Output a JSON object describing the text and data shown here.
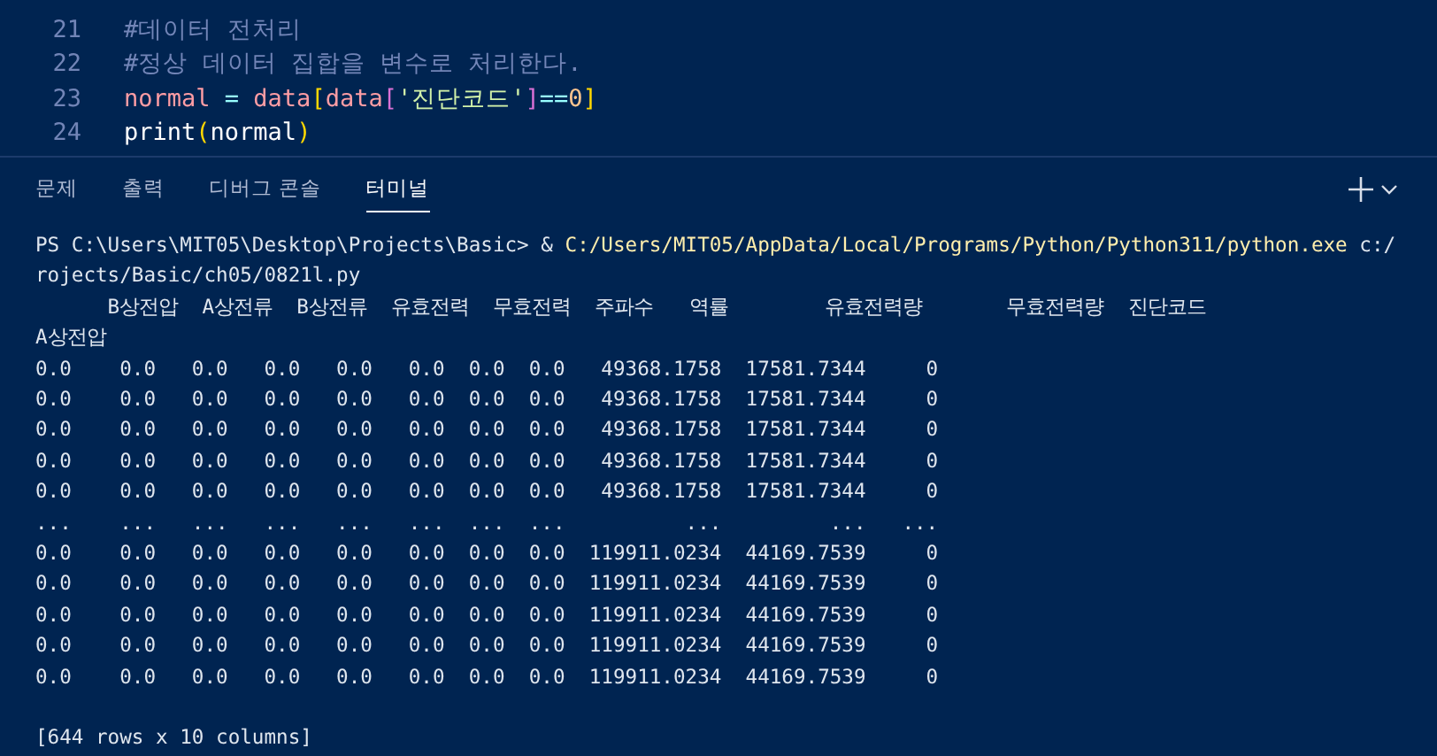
{
  "editor": {
    "lines": [
      {
        "number": "21",
        "tokens": [
          {
            "kind": "comment",
            "text": "#데이터 전처리"
          }
        ]
      },
      {
        "number": "22",
        "tokens": [
          {
            "kind": "comment",
            "text": "#정상 데이터 집합을 변수로 처리한다."
          }
        ]
      },
      {
        "number": "23",
        "tokens": [
          {
            "kind": "variable",
            "text": "normal"
          },
          {
            "kind": "operator",
            "text": " = "
          },
          {
            "kind": "variable",
            "text": "data"
          },
          {
            "kind": "bracket1",
            "text": "["
          },
          {
            "kind": "variable",
            "text": "data"
          },
          {
            "kind": "bracket2",
            "text": "["
          },
          {
            "kind": "string",
            "text": "'진단코드'"
          },
          {
            "kind": "bracket2",
            "text": "]"
          },
          {
            "kind": "operator",
            "text": "=="
          },
          {
            "kind": "number",
            "text": "0"
          },
          {
            "kind": "bracket1",
            "text": "]"
          }
        ]
      },
      {
        "number": "24",
        "tokens": [
          {
            "kind": "plain",
            "text": "print"
          },
          {
            "kind": "bracket1",
            "text": "("
          },
          {
            "kind": "plain",
            "text": "normal"
          },
          {
            "kind": "bracket1",
            "text": ")"
          }
        ]
      }
    ]
  },
  "panel": {
    "tabs": [
      {
        "label": "문제",
        "selected": false
      },
      {
        "label": "출력",
        "selected": false
      },
      {
        "label": "디버그 콘솔",
        "selected": false
      },
      {
        "label": "터미널",
        "selected": true
      }
    ]
  },
  "terminal": {
    "lines": [
      {
        "kind": "prompt",
        "prompt": "PS C:\\Users\\MIT05\\Desktop\\Projects\\Basic> & ",
        "command": "C:/Users/MIT05/AppData/Local/Programs/Python/Python311/python.exe",
        "argument": " c:/"
      },
      {
        "kind": "text",
        "text": "rojects/Basic/ch05/0821l.py"
      },
      {
        "kind": "text",
        "text": "      B상전압  A상전류  B상전류  유효전력  무효전력  주파수   역률        유효전력량       무효전력량  진단코드"
      },
      {
        "kind": "text",
        "text": "A상전압"
      },
      {
        "kind": "text",
        "text": "0.0    0.0   0.0   0.0   0.0   0.0  0.0  0.0   49368.1758  17581.7344     0"
      },
      {
        "kind": "text",
        "text": "0.0    0.0   0.0   0.0   0.0   0.0  0.0  0.0   49368.1758  17581.7344     0"
      },
      {
        "kind": "text",
        "text": "0.0    0.0   0.0   0.0   0.0   0.0  0.0  0.0   49368.1758  17581.7344     0"
      },
      {
        "kind": "text",
        "text": "0.0    0.0   0.0   0.0   0.0   0.0  0.0  0.0   49368.1758  17581.7344     0"
      },
      {
        "kind": "text",
        "text": "0.0    0.0   0.0   0.0   0.0   0.0  0.0  0.0   49368.1758  17581.7344     0"
      },
      {
        "kind": "text",
        "text": "...    ...   ...   ...   ...   ...  ...  ...          ...         ...   ..."
      },
      {
        "kind": "text",
        "text": "0.0    0.0   0.0   0.0   0.0   0.0  0.0  0.0  119911.0234  44169.7539     0"
      },
      {
        "kind": "text",
        "text": "0.0    0.0   0.0   0.0   0.0   0.0  0.0  0.0  119911.0234  44169.7539     0"
      },
      {
        "kind": "text",
        "text": "0.0    0.0   0.0   0.0   0.0   0.0  0.0  0.0  119911.0234  44169.7539     0"
      },
      {
        "kind": "text",
        "text": "0.0    0.0   0.0   0.0   0.0   0.0  0.0  0.0  119911.0234  44169.7539     0"
      },
      {
        "kind": "text",
        "text": "0.0    0.0   0.0   0.0   0.0   0.0  0.0  0.0  119911.0234  44169.7539     0"
      },
      {
        "kind": "blank"
      },
      {
        "kind": "text",
        "text": "[644 rows x 10 columns]"
      }
    ]
  }
}
